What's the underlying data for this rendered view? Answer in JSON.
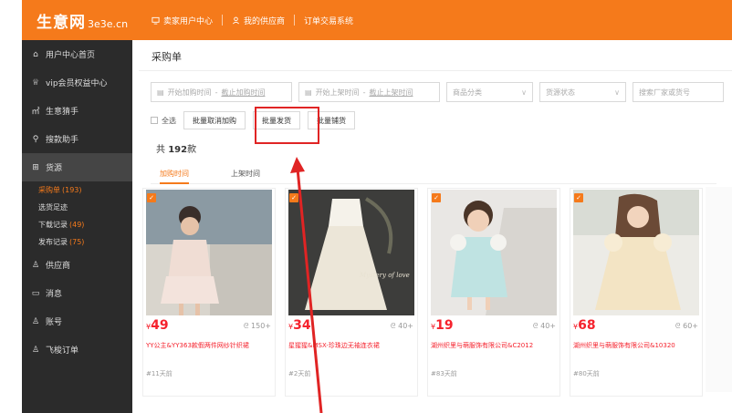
{
  "topbar": {
    "logo_cn": "生意网",
    "logo_en": "3e3e.cn",
    "nav": [
      {
        "label": "卖家用户中心",
        "icon": "monitor-icon"
      },
      {
        "label": "我的供应商",
        "icon": "user-icon"
      },
      {
        "label": "订单交易系统",
        "icon": ""
      }
    ]
  },
  "sidebar": {
    "items": [
      {
        "label": "用户中心首页",
        "icon": "home-icon"
      },
      {
        "label": "vip会员权益中心",
        "icon": "crown-icon"
      },
      {
        "label": "生意猜手",
        "icon": "chart-icon"
      },
      {
        "label": "搜款助手",
        "icon": "search-icon"
      },
      {
        "label": "货源",
        "icon": "grid-icon"
      }
    ],
    "sub": [
      {
        "label": "采购单",
        "count": "(193)"
      },
      {
        "label": "选货足迹",
        "count": ""
      },
      {
        "label": "下载记录",
        "count": "(49)"
      },
      {
        "label": "发布记录",
        "count": "(75)"
      }
    ],
    "items2": [
      {
        "label": "供应商",
        "icon": "user-icon"
      },
      {
        "label": "消息",
        "icon": "message-icon"
      },
      {
        "label": "账号",
        "icon": "account-icon"
      },
      {
        "label": "飞梭订单",
        "icon": "order-icon"
      }
    ]
  },
  "main": {
    "title": "采购单",
    "filters": {
      "add_time_start": "开始加购时间",
      "add_time_sep": "-",
      "add_time_end": "截止加购时间",
      "shelf_time_start": "开始上架时间",
      "shelf_time_sep": "-",
      "shelf_time_end": "截止上架时间",
      "category": "商品分类",
      "status": "货源状态",
      "search": "搜索厂家或货号"
    },
    "select_all": "全选",
    "buttons": [
      "批量取消加购",
      "批量发货",
      "批量铺货"
    ],
    "count_prefix": "共 ",
    "count_num": "192",
    "count_suffix": "款",
    "tabs": [
      "加购时间",
      "上架时间"
    ],
    "cards": [
      {
        "price": "49",
        "sales": "150+",
        "desc": "YY公主&YY363款假两件网纱针织裙",
        "tag": "#11天前"
      },
      {
        "price": "34",
        "sales": "40+",
        "desc": "星猩猩&MSX-珍珠边无袖连衣裙",
        "tag": "#2天前"
      },
      {
        "price": "19",
        "sales": "40+",
        "desc": "湖州织里与萌服饰有限公司&C2012",
        "tag": "#83天前"
      },
      {
        "price": "68",
        "sales": "60+",
        "desc": "湖州织里与萌服饰有限公司&10320",
        "tag": "#80天前"
      }
    ],
    "currency": "¥",
    "overlay_text": "Mystery of love"
  },
  "colors": {
    "brand": "#f57a1b",
    "sidebar": "#2b2b2b",
    "price": "#f5222d",
    "highlight": "#e02424"
  }
}
